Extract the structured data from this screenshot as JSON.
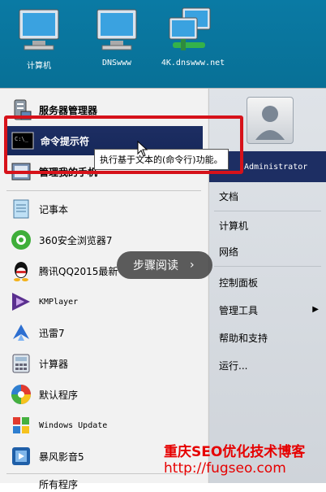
{
  "desktop": {
    "icons": [
      {
        "label": "计算机",
        "icon": "computer-icon"
      },
      {
        "label": "DNSwww",
        "icon": "computer-icon"
      },
      {
        "label": "4K.dnswww.net",
        "icon": "network-computer-icon"
      }
    ]
  },
  "start_menu": {
    "left_items": [
      {
        "label": "服务器管理器",
        "icon": "server-manager-icon"
      },
      {
        "label": "命令提示符",
        "icon": "cmd-icon"
      },
      {
        "label": "管理我的手机",
        "icon": "phone-manager-icon"
      },
      {
        "label": "记事本",
        "icon": "notepad-icon"
      },
      {
        "label": "360安全浏览器7",
        "icon": "360-browser-icon"
      },
      {
        "label": "腾讯QQ2015最新",
        "icon": "qq-icon"
      },
      {
        "label": "KMPlayer",
        "icon": "kmplayer-icon"
      },
      {
        "label": "迅雷7",
        "icon": "thunder-icon"
      },
      {
        "label": "计算器",
        "icon": "calculator-icon"
      },
      {
        "label": "默认程序",
        "icon": "default-programs-icon"
      },
      {
        "label": "Windows Update",
        "icon": "windows-update-icon"
      },
      {
        "label": "暴风影音5",
        "icon": "baofeng-icon"
      },
      {
        "label": "所有程序",
        "icon": "all-programs-icon"
      }
    ],
    "tooltip": "执行基于文本的(命令行)功能。",
    "user_name": "Administrator",
    "right_items": [
      "文档",
      "计算机",
      "网络",
      "控制面板",
      "管理工具",
      "帮助和支持",
      "运行..."
    ],
    "right_arrow": "▶"
  },
  "overlay": {
    "step_read": "步骤阅读",
    "step_chevron": "›"
  },
  "watermark": {
    "line1": "重庆SEO优化技术博客",
    "line2": "http://fugseo.com"
  },
  "colors": {
    "selection": "#1d2e63",
    "highlight_border": "#d6121a",
    "watermark": "#e60000",
    "desktop": "#0a7aa4"
  }
}
